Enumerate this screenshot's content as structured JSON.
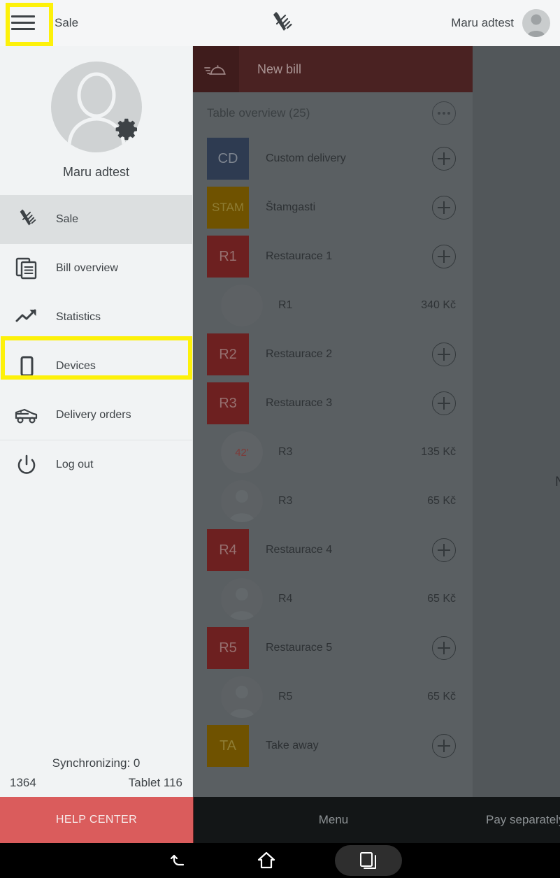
{
  "topbar": {
    "menu_icon": "hamburger-icon",
    "title": "Sale",
    "center_icon": "cutlery-icon",
    "user": "Maru adtest",
    "avatar_icon": "person-avatar-icon"
  },
  "sidebar": {
    "profile": {
      "avatar_icon": "person-avatar-icon",
      "settings_icon": "gear-icon",
      "name": "Maru adtest"
    },
    "items": [
      {
        "label": "Sale",
        "icon": "cutlery-icon",
        "active": true
      },
      {
        "label": "Bill overview",
        "icon": "documents-icon",
        "active": false
      },
      {
        "label": "Statistics",
        "icon": "trend-up-icon",
        "active": false
      },
      {
        "label": "Devices",
        "icon": "tablet-icon",
        "active": false
      },
      {
        "label": "Delivery orders",
        "icon": "delivery-car-icon",
        "active": false
      },
      {
        "label": "Log out",
        "icon": "power-icon",
        "active": false
      }
    ],
    "sync_status": "Synchronizing: 0",
    "build_number": "1364",
    "device_name": "Tablet 116",
    "help_center_label": "HELP CENTER"
  },
  "content": {
    "new_bill": {
      "icon": "food-dome-icon",
      "label": "New bill"
    },
    "list_header": {
      "title": "Table overview (25)",
      "more_icon": "more-horizontal-icon"
    },
    "rows": [
      {
        "type": "table",
        "code": "CD",
        "label": "Custom delivery",
        "color": "#2e3b51",
        "text_color": "#7d848f",
        "add_icon": "plus-circle-icon"
      },
      {
        "type": "table",
        "code": "STAM",
        "label": "Štamgasti",
        "color": "#6f5200",
        "text_color": "#8e7c33",
        "add_icon": "plus-circle-icon"
      },
      {
        "type": "table",
        "code": "R1",
        "label": "Restaurace 1",
        "color": "#6d2020",
        "text_color": "#96706f",
        "add_icon": "plus-circle-icon"
      },
      {
        "type": "bill",
        "avatar": "person-avatar-icon",
        "label": "R1",
        "price": "340 Kč"
      },
      {
        "type": "table",
        "code": "R2",
        "label": "Restaurace 2",
        "color": "#6d2020",
        "text_color": "#96706f",
        "add_icon": "plus-circle-icon"
      },
      {
        "type": "table",
        "code": "R3",
        "label": "Restaurace 3",
        "color": "#6d2020",
        "text_color": "#96706f",
        "add_icon": "plus-circle-icon"
      },
      {
        "type": "bill",
        "timer": "42'",
        "label": "R3",
        "price": "135 Kč"
      },
      {
        "type": "bill",
        "avatar": "person-avatar-icon",
        "label": "R3",
        "price": "65 Kč"
      },
      {
        "type": "table",
        "code": "R4",
        "label": "Restaurace 4",
        "color": "#6d2020",
        "text_color": "#96706f",
        "add_icon": "plus-circle-icon"
      },
      {
        "type": "bill",
        "avatar": "person-avatar-icon",
        "label": "R4",
        "price": "65 Kč"
      },
      {
        "type": "table",
        "code": "R5",
        "label": "Restaurace 5",
        "color": "#6d2020",
        "text_color": "#96706f",
        "add_icon": "plus-circle-icon"
      },
      {
        "type": "bill",
        "avatar": "person-avatar-icon",
        "label": "R5",
        "price": "65 Kč"
      },
      {
        "type": "table",
        "code": "TA",
        "label": "Take away",
        "color": "#6f5200",
        "text_color": "#8e7c33",
        "add_icon": "plus-circle-icon"
      }
    ],
    "right_pane_partial_text": "N"
  },
  "action_bar": {
    "menu_label": "Menu",
    "pay_label": "Pay separately"
  },
  "system_nav": {
    "back_icon": "back-arrow-icon",
    "home_icon": "home-icon",
    "recents_icon": "recents-icon"
  },
  "highlights": [
    {
      "target": "hamburger-menu-button"
    },
    {
      "target": "sidebar-item-devices"
    }
  ],
  "colors": {
    "accent_red": "#da5c5c",
    "bar_dark_red": "#4a2222",
    "highlight_yellow": "#fdf10a",
    "dim_overlay": "#52575a"
  }
}
